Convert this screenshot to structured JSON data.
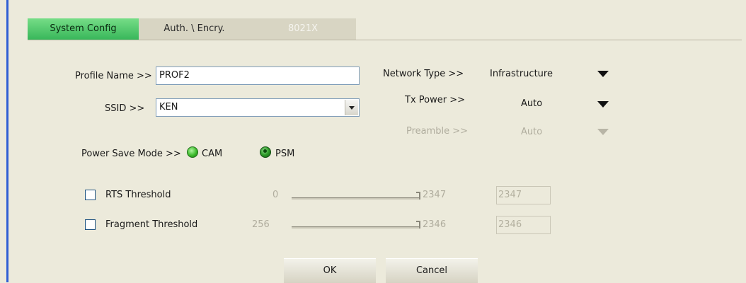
{
  "tabs": [
    {
      "label": "System Config"
    },
    {
      "label": "Auth. \\ Encry."
    },
    {
      "label": "8021X"
    }
  ],
  "profile": {
    "label": "Profile Name >>",
    "value": "PROF2"
  },
  "ssid": {
    "label": "SSID >>",
    "value": "KEN"
  },
  "network_type": {
    "label": "Network Type >>",
    "value": "Infrastructure"
  },
  "tx_power": {
    "label": "Tx Power >>",
    "value": "Auto"
  },
  "preamble": {
    "label": "Preamble >>",
    "value": "Auto"
  },
  "power_save": {
    "label": "Power Save Mode >>",
    "options": [
      {
        "label": "CAM",
        "selected": true
      },
      {
        "label": "PSM",
        "selected": false
      }
    ]
  },
  "rts": {
    "label": "RTS Threshold",
    "checked": false,
    "min": "0",
    "max": "2347",
    "value": "2347"
  },
  "fragment": {
    "label": "Fragment Threshold",
    "checked": false,
    "min": "256",
    "max": "2346",
    "value": "2346"
  },
  "buttons": {
    "ok": "OK",
    "cancel": "Cancel"
  }
}
